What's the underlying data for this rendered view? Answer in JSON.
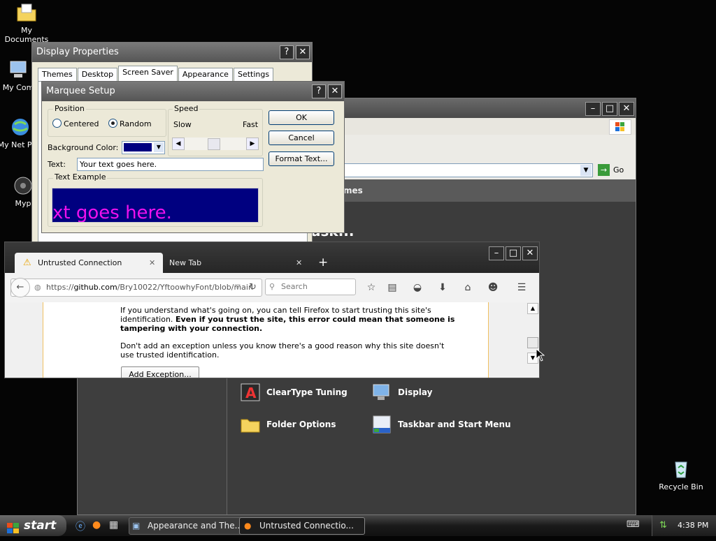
{
  "desktop": {
    "icons": [
      {
        "label": "My Documents"
      },
      {
        "label": "My Com"
      },
      {
        "label": "My Net Plac"
      },
      {
        "label": "Myp"
      },
      {
        "label": "Recycle Bin"
      }
    ]
  },
  "control_panel": {
    "go_label": "Go",
    "category_header": "mes",
    "heading": "ask...",
    "items": [
      {
        "label": "ClearType Tuning",
        "icon": "cleartype-icon"
      },
      {
        "label": "Display",
        "icon": "display-icon"
      },
      {
        "label": "Folder Options",
        "icon": "folder-options-icon"
      },
      {
        "label": "Taskbar and Start Menu",
        "icon": "taskbar-icon"
      }
    ]
  },
  "display_properties": {
    "title": "Display Properties",
    "tabs": [
      "Themes",
      "Desktop",
      "Screen Saver",
      "Appearance",
      "Settings"
    ],
    "active_tab": "Screen Saver"
  },
  "marquee_setup": {
    "title": "Marquee Setup",
    "position_label": "Position",
    "centered_label": "Centered",
    "random_label": "Random",
    "selected_position": "Random",
    "speed_label": "Speed",
    "slow_label": "Slow",
    "fast_label": "Fast",
    "bg_color_label": "Background Color:",
    "bg_color_value": "#000080",
    "text_label": "Text:",
    "text_value": "Your text goes here.",
    "text_example_label": "Text Example",
    "preview_text": "xt goes here.",
    "ok_label": "OK",
    "cancel_label": "Cancel",
    "format_text_label": "Format Text..."
  },
  "firefox": {
    "tabs": [
      {
        "label": "Untrusted Connection",
        "icon": "warning-icon"
      },
      {
        "label": "New Tab"
      }
    ],
    "url_prefix": "https://",
    "url_host": "github.com",
    "url_path": "/Bry10022/YftoowhyFont/blob/main",
    "search_placeholder": "Search",
    "para1_normal": "If you understand what's going on, you can tell Firefox to start trusting this site's identification. ",
    "para1_bold": "Even if you trust the site, this error could mean that someone is tampering with your connection.",
    "para2": "Don't add an exception unless you know there's a good reason why this site doesn't use trusted identification.",
    "add_exception_label": "Add Exception..."
  },
  "taskbar": {
    "start_label": "start",
    "tasks": [
      {
        "label": "Appearance and The...",
        "active": false
      },
      {
        "label": "Untrusted Connectio...",
        "active": true
      }
    ],
    "clock": "4:38 PM"
  }
}
